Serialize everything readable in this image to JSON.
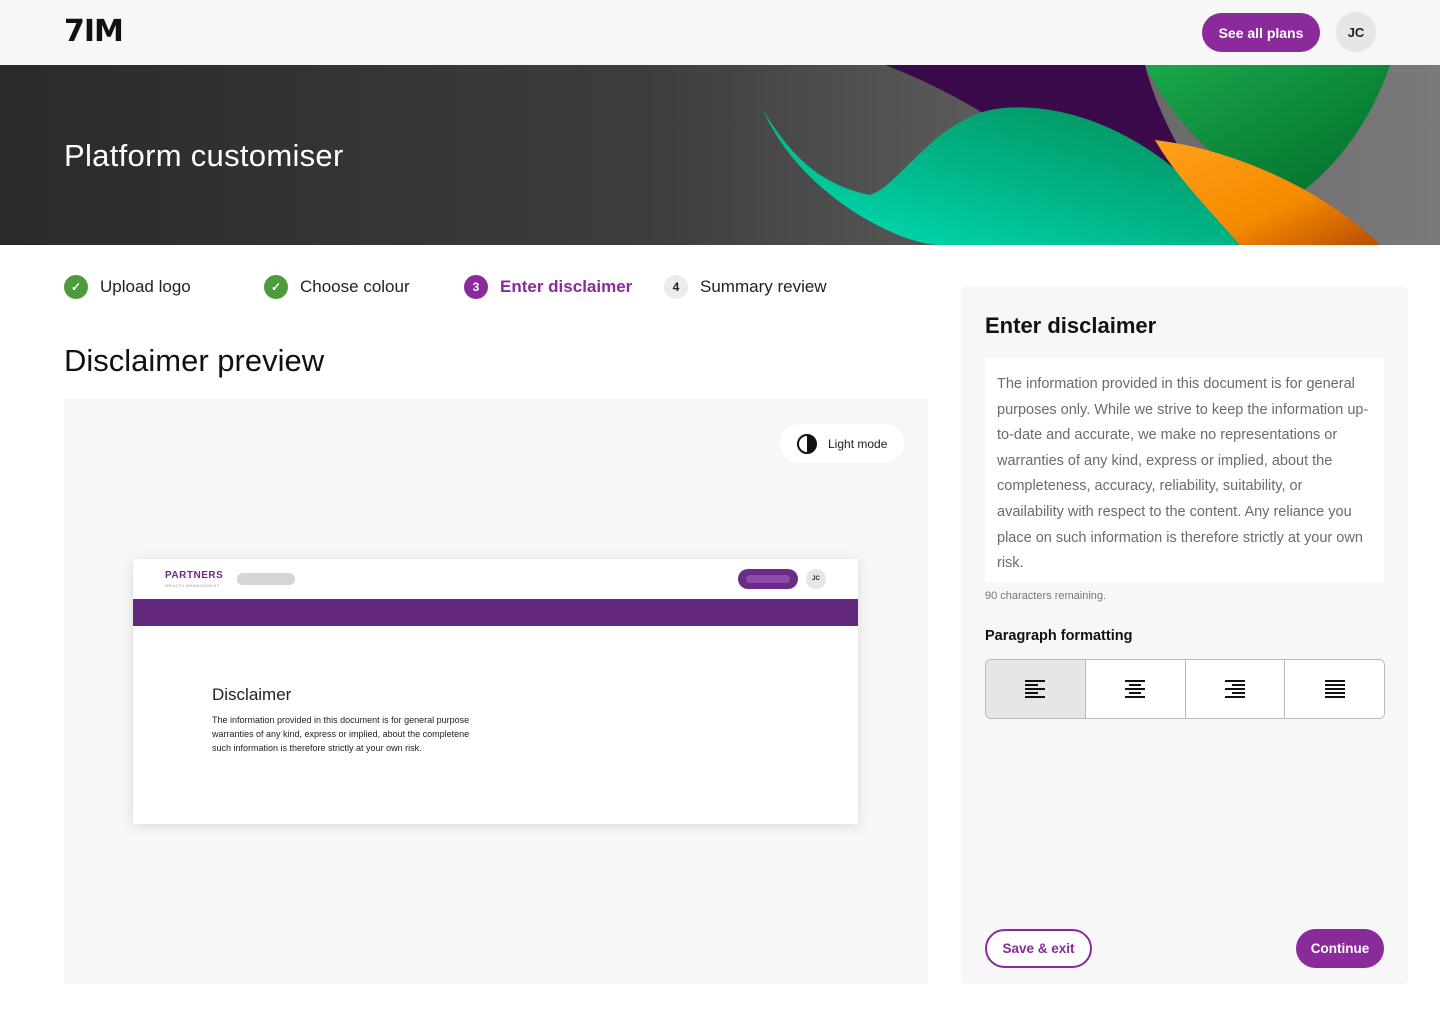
{
  "nav": {
    "logo": "7IM",
    "plans_label": "See all plans",
    "avatar_initials": "JC"
  },
  "hero": {
    "title": "Platform customiser"
  },
  "stepper": {
    "steps": [
      {
        "label": "Upload logo",
        "state": "done",
        "marker": "✓"
      },
      {
        "label": "Choose colour",
        "state": "done",
        "marker": "✓"
      },
      {
        "label": "Enter disclaimer",
        "state": "active",
        "marker": "3"
      },
      {
        "label": "Summary review",
        "state": "todo",
        "marker": "4"
      }
    ]
  },
  "preview": {
    "title": "Disclaimer preview",
    "mode_label": "Light mode",
    "mock": {
      "brand": "PARTNERS",
      "brand_sub": "WEALTH MANAGEMENT",
      "avatar": "JC",
      "heading": "Disclaimer",
      "lines": [
        "The information provided in this document is for general purpose",
        "warranties of any kind, express or implied, about the completene",
        "such information is therefore strictly at your own risk."
      ]
    }
  },
  "panel": {
    "title": "Enter disclaimer",
    "disclaimer_text": "The information provided in this document is for general purposes only. While we strive to keep the information up-to-date and accurate, we make no representations or warranties of any kind, express or implied, about the completeness, accuracy, reliability, suitability, or availability with respect to the content. Any reliance you place on such information is therefore strictly at your own risk.",
    "chars_remaining": "90 characters remaining.",
    "formatting_label": "Paragraph formatting",
    "alignments": [
      "align-left-icon",
      "align-center-icon",
      "align-right-icon",
      "align-justify-icon"
    ],
    "selected_alignment": "align-left-icon",
    "save_label": "Save & exit",
    "continue_label": "Continue"
  },
  "colors": {
    "brand_purple": "#8a2a9b",
    "mock_purple": "#62287e",
    "done_green": "#4f9a3c"
  }
}
